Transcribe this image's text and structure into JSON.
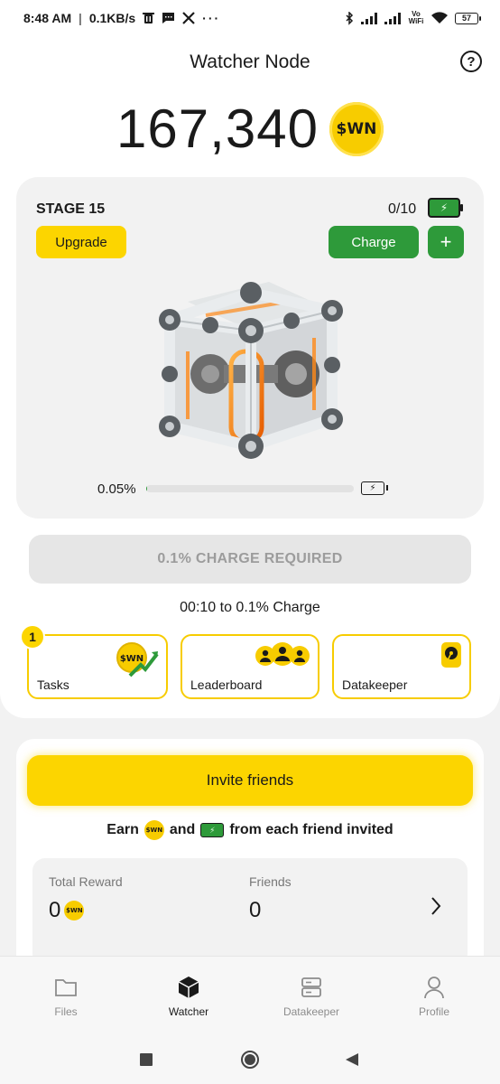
{
  "status_bar": {
    "time": "8:48 AM",
    "speed": "0.1KB/s",
    "battery": "57",
    "icons": [
      "trash-icon",
      "message-icon",
      "x-icon",
      "more-icon",
      "bluetooth-icon",
      "signal-icon",
      "signal-icon",
      "vowifi-icon",
      "wifi-icon",
      "battery-icon"
    ],
    "vowifi_label": "Vo WiFi"
  },
  "header": {
    "title": "Watcher Node",
    "help_icon": "question-icon"
  },
  "balance": {
    "value": "167,340",
    "token": "$WN"
  },
  "stage": {
    "label": "STAGE 15",
    "charges": "0/10",
    "upgrade_label": "Upgrade",
    "charge_label": "Charge",
    "plus_label": "+",
    "progress_text": "0.05%",
    "progress_fraction": 0.0005
  },
  "charge_required": {
    "label": "0.1% CHARGE REQUIRED",
    "timer": "00:10 to 0.1% Charge"
  },
  "features": {
    "tasks": {
      "label": "Tasks",
      "badge": "1",
      "icon": "wn-coin-arrow-icon",
      "icon_text": "$WN"
    },
    "leaderboard": {
      "label": "Leaderboard",
      "icon": "users-icon"
    },
    "datakeeper": {
      "label": "Datakeeper",
      "icon": "hard-drive-icon"
    }
  },
  "invite": {
    "button_label": "Invite friends",
    "earn_prefix": "Earn",
    "earn_and": "and",
    "earn_suffix": "from each friend invited",
    "total_reward_label": "Total Reward",
    "total_reward_value": "0",
    "friends_label": "Friends",
    "friends_value": "0"
  },
  "bottom_nav": {
    "items": [
      {
        "label": "Files",
        "icon": "folder-icon",
        "active": false
      },
      {
        "label": "Watcher",
        "icon": "cube-icon",
        "active": true
      },
      {
        "label": "Datakeeper",
        "icon": "server-icon",
        "active": false
      },
      {
        "label": "Profile",
        "icon": "user-icon",
        "active": false
      }
    ]
  },
  "colors": {
    "accent_yellow": "#fcd500",
    "accent_green": "#2e9a3a",
    "background": "#f2f2f2"
  }
}
